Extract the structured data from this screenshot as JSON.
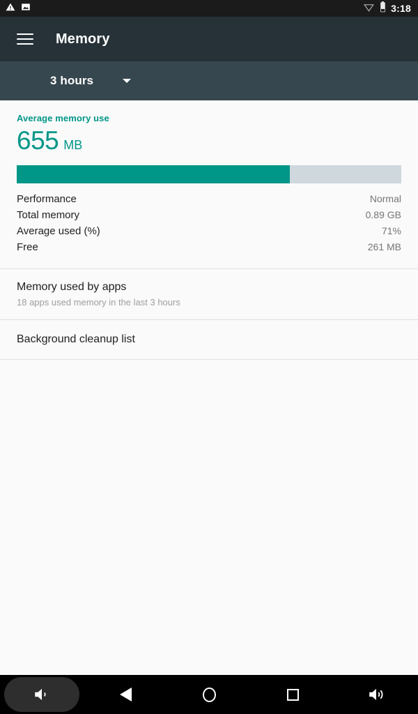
{
  "status_bar": {
    "icons_left": [
      "warning-triangle-icon",
      "image-icon"
    ],
    "icons_right": [
      "wifi-icon",
      "battery-icon"
    ],
    "time": "3:18"
  },
  "app_bar": {
    "menu_icon": "hamburger-menu-icon",
    "title": "Memory"
  },
  "period_selector": {
    "value": "3 hours",
    "caret_icon": "chevron-down-icon"
  },
  "summary": {
    "caption": "Average memory use",
    "number": "655",
    "unit": "MB",
    "bar_fill_percent": 71,
    "accent_color": "#009688",
    "track_color": "#CFD8DC"
  },
  "stats": [
    {
      "label": "Performance",
      "value": "Normal"
    },
    {
      "label": "Total memory",
      "value": "0.89 GB"
    },
    {
      "label": "Average used (%)",
      "value": "71%"
    },
    {
      "label": "Free",
      "value": "261 MB"
    }
  ],
  "sections": {
    "memory_used_by_apps": {
      "title": "Memory used by apps",
      "subtitle": "18 apps used memory in the last 3 hours"
    },
    "background_cleanup": {
      "title": "Background cleanup list"
    }
  },
  "nav_bar": {
    "buttons": [
      {
        "name": "volume-down-icon",
        "pressed": true
      },
      {
        "name": "back-icon",
        "pressed": false
      },
      {
        "name": "home-icon",
        "pressed": false
      },
      {
        "name": "recents-icon",
        "pressed": false
      },
      {
        "name": "volume-up-icon",
        "pressed": false
      }
    ]
  }
}
